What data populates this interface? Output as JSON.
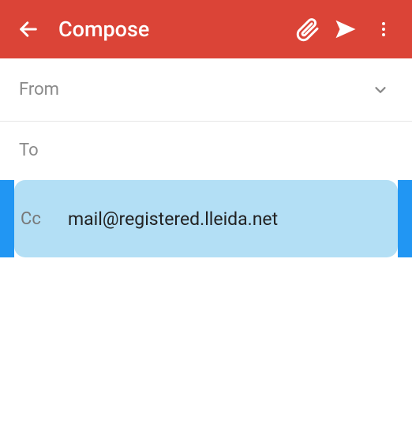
{
  "header": {
    "title": "Compose"
  },
  "fields": {
    "from": {
      "label": "From"
    },
    "to": {
      "label": "To"
    },
    "cc": {
      "label": "Cc",
      "value": "mail@registered.lleida.net"
    }
  }
}
